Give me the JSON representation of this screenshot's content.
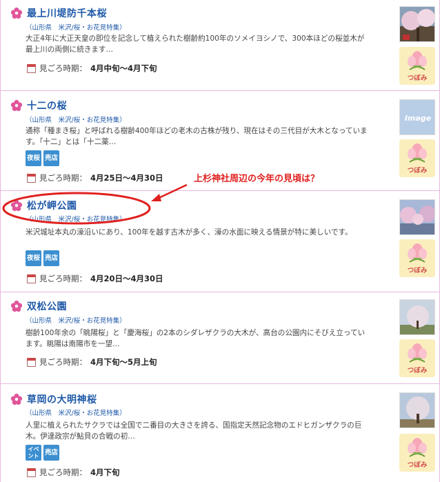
{
  "entries": [
    {
      "title": "最上川堤防千本桜",
      "meta": "（山形県　米沢/桜・お花見特集）",
      "desc": "大正4年に大正天皇の即位を記念して植えられた樹齢約100年のソメイヨシノで、300本ほどの桜並木が最上川の両側に続きます…",
      "tags": [],
      "period_label": "見ごろ時期：",
      "period_value": "4月中旬～4月下旬",
      "status": "つぼみ"
    },
    {
      "title": "十二の桜",
      "meta": "（山形県　米沢/桜・お花見特集）",
      "desc": "通称「種まき桜」と呼ばれる樹齢400年ほどの老木の古株が残り、現在はその三代目が大木となっています。「十二」とは「十二薬…",
      "tags": [
        "夜桜",
        "売店"
      ],
      "period_label": "見ごろ時期：",
      "period_value": "4月25日～4月30日",
      "status": "つぼみ",
      "thumb_text": "Image"
    },
    {
      "title": "松が岬公園",
      "meta": "（山形県　米沢/桜・お花見特集）",
      "desc": "米沢城址本丸の濠沿いにあり、100年を越す古木が多く、濠の水面に映える情景が特に美しいです。",
      "tags": [
        "夜桜",
        "売店"
      ],
      "period_label": "見ごろ時期：",
      "period_value": "4月20日～4月30日",
      "status": "つぼみ"
    },
    {
      "title": "双松公園",
      "meta": "（山形県　米沢/桜・お花見特集）",
      "desc": "樹齢100年余の「眺陽桜」と「慶海桜」の2本のシダレザクラの大木が、高台の公園内にそびえ立っています。眺陽は南陽市を一望…",
      "tags": [],
      "period_label": "見ごろ時期：",
      "period_value": "4月下旬～5月上旬",
      "status": "つぼみ"
    },
    {
      "title": "草岡の大明神桜",
      "meta": "（山形県　米沢/桜・お花見特集）",
      "desc": "人里に植えられたサクラでは全国で二番目の大きさを誇る、国指定天然記念物のエドヒガンザクラの巨木。伊達政宗が鮎貝の合戦の初…",
      "tags": [
        "イベント",
        "売店"
      ],
      "period_label": "見ごろ時期：",
      "period_value": "4月下旬",
      "status": "つぼみ"
    }
  ],
  "annotation": "上杉神社周辺の今年の見頃は？",
  "colors": {
    "link": "#1f5aa8",
    "annotation": "#e02020",
    "border": "#e8b8dd",
    "tag": "#3c8fd0",
    "badge_bg": "#fbeebd"
  }
}
